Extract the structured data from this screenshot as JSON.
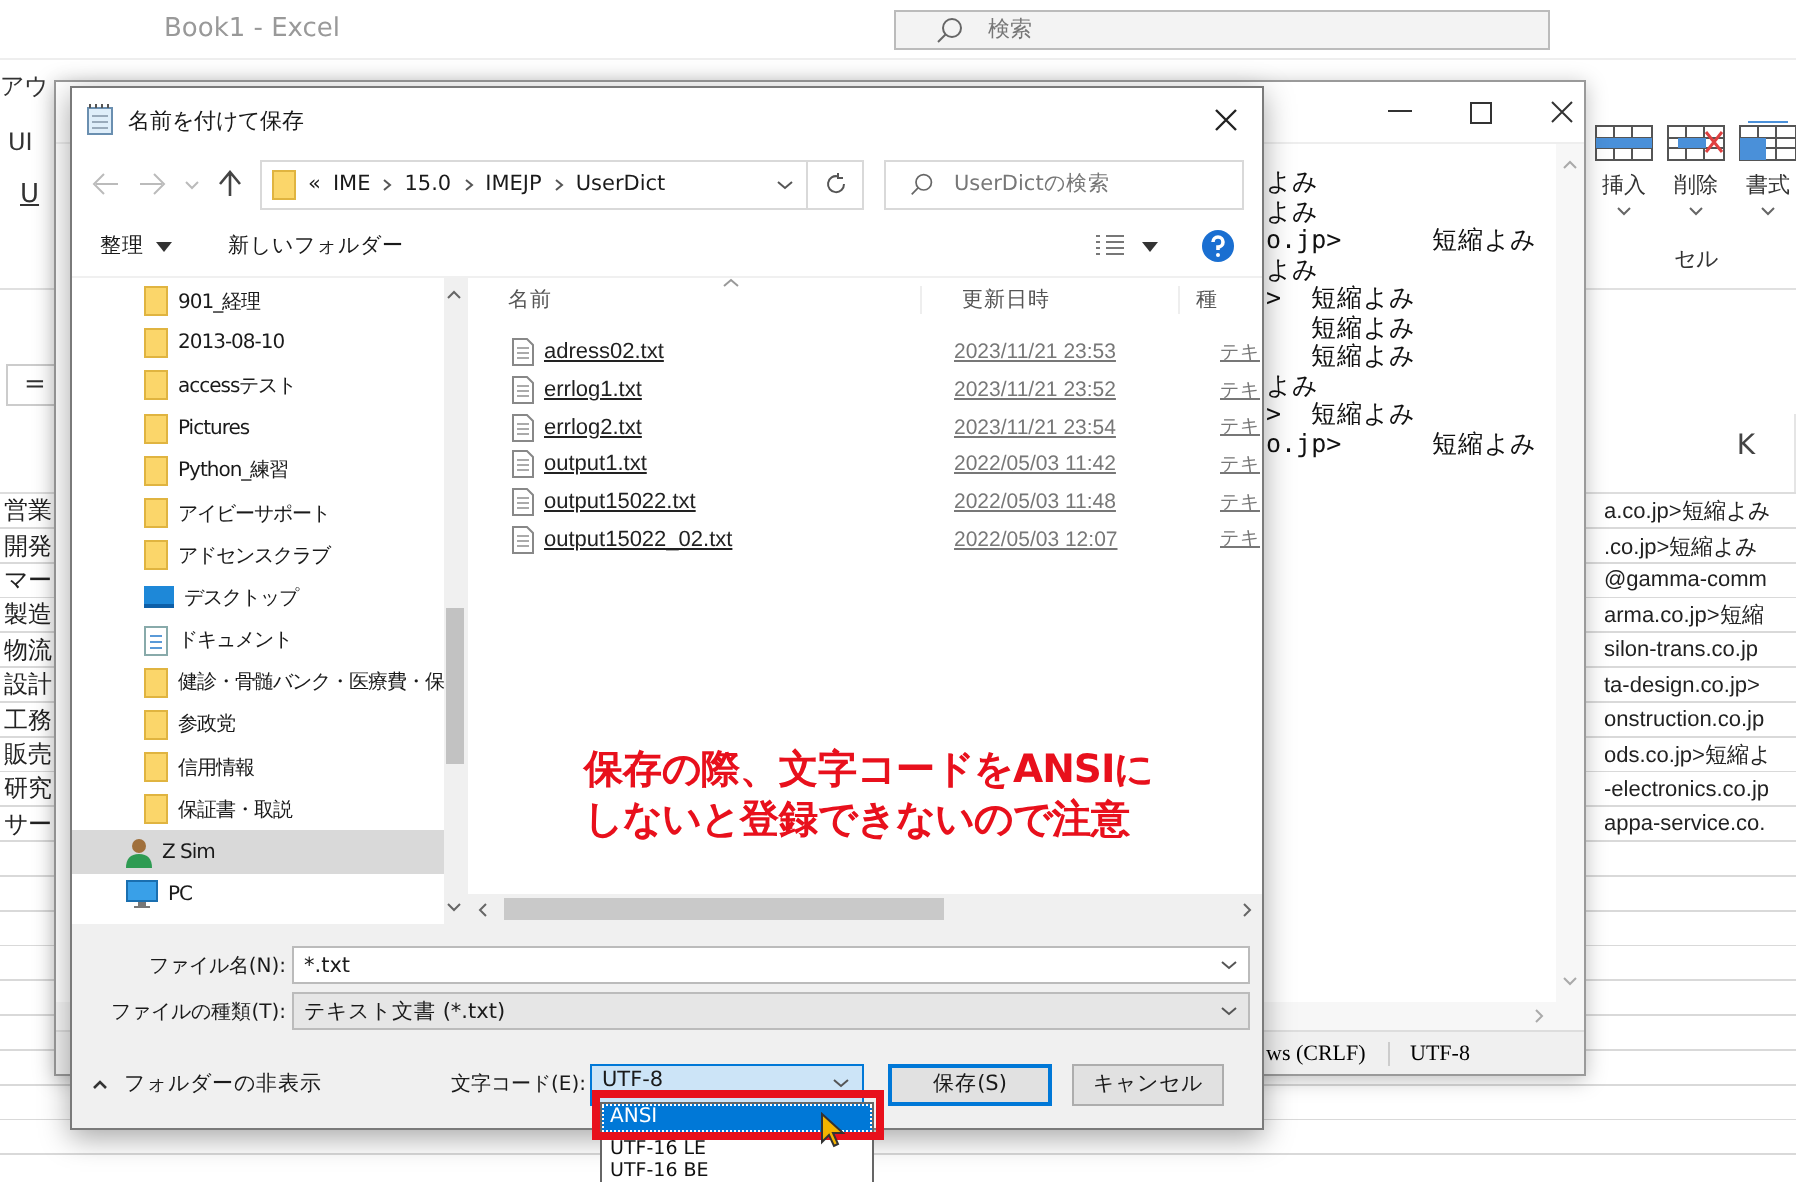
{
  "excel": {
    "title": "Book1  -  Excel",
    "search_placeholder": "検索",
    "ribbon_tab": "アウ",
    "font_name": "UI",
    "underline_button": "U",
    "cell_buttons": [
      {
        "label": "挿入",
        "kind": "insert"
      },
      {
        "label": "削除",
        "kind": "delete"
      },
      {
        "label": "書式",
        "kind": "format"
      }
    ],
    "cells_group": "セル",
    "formula_label": "=",
    "column_header": "K",
    "rows": [
      {
        "label": "営業",
        "k": "a.co.jp>短縮よみ"
      },
      {
        "label": "開発",
        "k": ".co.jp>短縮よみ"
      },
      {
        "label": "マー",
        "k": "@gamma-comm"
      },
      {
        "label": "製造",
        "k": "arma.co.jp>短縮"
      },
      {
        "label": "物流",
        "k": "silon-trans.co.jp"
      },
      {
        "label": "設計",
        "k": "ta-design.co.jp>"
      },
      {
        "label": "工務",
        "k": "onstruction.co.jp"
      },
      {
        "label": "販売",
        "k": "ods.co.jp>短縮よ"
      },
      {
        "label": "研究",
        "k": "-electronics.co.jp"
      },
      {
        "label": "サー",
        "k": "appa-service.co."
      }
    ]
  },
  "notepad": {
    "lines": [
      "よみ",
      "よみ",
      "o.jp>      短縮よみ",
      "よみ",
      ">  短縮よみ",
      "   短縮よみ",
      "   短縮よみ",
      "よみ",
      ">  短縮よみ",
      "o.jp>      短縮よみ"
    ],
    "status": [
      "ws (CRLF)",
      "UTF-8"
    ]
  },
  "dialog": {
    "title": "名前を付けて保存",
    "path": [
      "«",
      "IME",
      "15.0",
      "IMEJP",
      "UserDict"
    ],
    "search_placeholder": "UserDictの検索",
    "organize": "整理",
    "new_folder": "新しいフォルダー",
    "nav_items": [
      {
        "label": "901_経理",
        "kind": "folder",
        "selected": false
      },
      {
        "label": "2013-08-10",
        "kind": "folder",
        "selected": false
      },
      {
        "label": "accessテスト",
        "kind": "folder",
        "selected": false
      },
      {
        "label": "Pictures",
        "kind": "folder",
        "selected": false
      },
      {
        "label": "Python_練習",
        "kind": "folder",
        "selected": false
      },
      {
        "label": "アイビーサポート",
        "kind": "folder",
        "selected": false
      },
      {
        "label": "アドセンスクラブ",
        "kind": "folder",
        "selected": false
      },
      {
        "label": "デスクトップ",
        "kind": "desktop",
        "selected": false
      },
      {
        "label": "ドキュメント",
        "kind": "document",
        "selected": false
      },
      {
        "label": "健診・骨髄バンク・医療費・保",
        "kind": "folder",
        "selected": false
      },
      {
        "label": "参政党",
        "kind": "folder",
        "selected": false
      },
      {
        "label": "信用情報",
        "kind": "folder",
        "selected": false
      },
      {
        "label": "保証書・取説",
        "kind": "folder",
        "selected": false
      },
      {
        "label": "Z Sim",
        "kind": "user",
        "selected": true
      },
      {
        "label": "PC",
        "kind": "pc",
        "selected": false
      }
    ],
    "columns": [
      "名前",
      "更新日時",
      "種"
    ],
    "files": [
      {
        "name": "adress02.txt",
        "modified": "2023/11/21 23:53",
        "type": "テキ"
      },
      {
        "name": "errlog1.txt",
        "modified": "2023/11/21 23:52",
        "type": "テキ"
      },
      {
        "name": "errlog2.txt",
        "modified": "2023/11/21 23:54",
        "type": "テキ"
      },
      {
        "name": "output1.txt",
        "modified": "2022/05/03 11:42",
        "type": "テキ"
      },
      {
        "name": "output15022.txt",
        "modified": "2022/05/03 11:48",
        "type": "テキ"
      },
      {
        "name": "output15022_02.txt",
        "modified": "2022/05/03 12:07",
        "type": "テキ"
      }
    ],
    "annotation": [
      "保存の際、文字コードをANSIに",
      "しないと登録できないので注意"
    ],
    "file_name": {
      "label": "ファイル名(N):",
      "value": "*.txt"
    },
    "file_type": {
      "label": "ファイルの種類(T):",
      "value": "テキスト文書 (*.txt)"
    },
    "hide_folders": "フォルダーの非表示",
    "encoding": {
      "label": "文字コード(E):",
      "value": "UTF-8",
      "options": [
        {
          "label": "ANSI",
          "selected": true
        },
        {
          "label": "UTF-16 LE",
          "selected": false
        },
        {
          "label": "UTF-16 BE",
          "selected": false
        }
      ]
    },
    "save": "保存(S)",
    "cancel": "キャンセル"
  }
}
